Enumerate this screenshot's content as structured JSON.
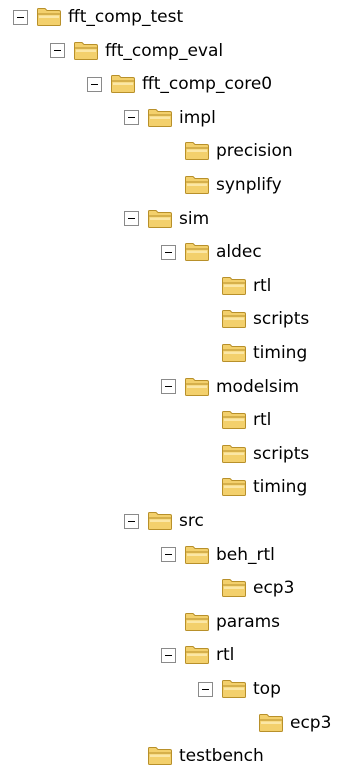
{
  "tree": {
    "nodes": [
      {
        "label": "fft_comp_test",
        "depth": 0,
        "expanded": true
      },
      {
        "label": "fft_comp_eval",
        "depth": 1,
        "expanded": true
      },
      {
        "label": "fft_comp_core0",
        "depth": 2,
        "expanded": true
      },
      {
        "label": "impl",
        "depth": 3,
        "expanded": true
      },
      {
        "label": "precision",
        "depth": 4,
        "expanded": false
      },
      {
        "label": "synplify",
        "depth": 4,
        "expanded": false
      },
      {
        "label": "sim",
        "depth": 3,
        "expanded": true
      },
      {
        "label": "aldec",
        "depth": 4,
        "expanded": true
      },
      {
        "label": "rtl",
        "depth": 5,
        "expanded": false
      },
      {
        "label": "scripts",
        "depth": 5,
        "expanded": false
      },
      {
        "label": "timing",
        "depth": 5,
        "expanded": false
      },
      {
        "label": "modelsim",
        "depth": 4,
        "expanded": true
      },
      {
        "label": "rtl",
        "depth": 5,
        "expanded": false
      },
      {
        "label": "scripts",
        "depth": 5,
        "expanded": false
      },
      {
        "label": "timing",
        "depth": 5,
        "expanded": false
      },
      {
        "label": "src",
        "depth": 3,
        "expanded": true
      },
      {
        "label": "beh_rtl",
        "depth": 4,
        "expanded": true
      },
      {
        "label": "ecp3",
        "depth": 5,
        "expanded": false
      },
      {
        "label": "params",
        "depth": 4,
        "expanded": false
      },
      {
        "label": "rtl",
        "depth": 4,
        "expanded": true
      },
      {
        "label": "top",
        "depth": 5,
        "expanded": true
      },
      {
        "label": "ecp3",
        "depth": 6,
        "expanded": false
      },
      {
        "label": "testbench",
        "depth": 3,
        "expanded": false
      }
    ]
  },
  "icons": {
    "folder": "folder-icon",
    "collapse": "collapse-toggle-icon"
  },
  "colors": {
    "folder_fill": "#f3d06c",
    "folder_light": "#fbe7a6",
    "folder_edge": "#b8902a",
    "toggle_border": "#8a8a8a"
  }
}
